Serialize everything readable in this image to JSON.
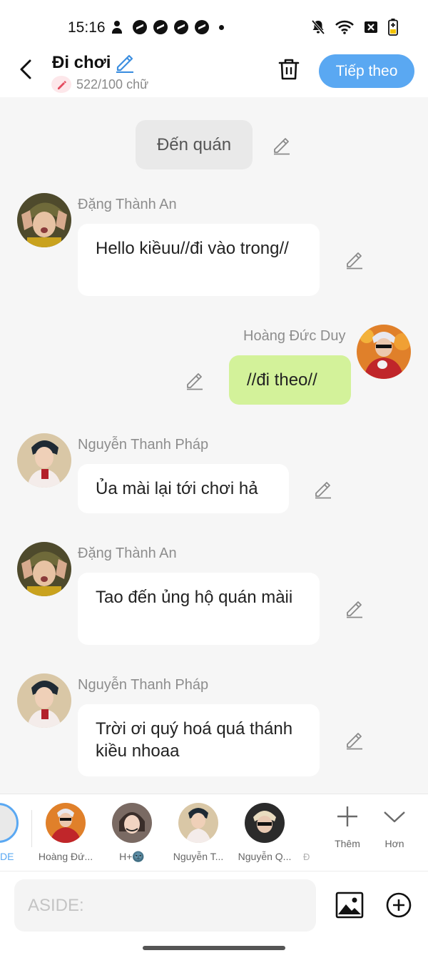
{
  "status_bar": {
    "time": "15:16"
  },
  "header": {
    "title": "Đi chơi",
    "counter": "522/100 chữ",
    "next_label": "Tiếp theo"
  },
  "chat": {
    "scene": "Đến quán",
    "messages": [
      {
        "sender": "Đặng Thành An",
        "text": "Hello kiềuu//đi vào trong//"
      },
      {
        "sender": "Hoàng Đức Duy",
        "text": "//đi theo//"
      },
      {
        "sender": "Nguyễn Thanh Pháp",
        "text": "Ủa mài lại tới chơi hả"
      },
      {
        "sender": "Đặng Thành An",
        "text": "Tao đến ủng hộ quán màii"
      },
      {
        "sender": "Nguyễn Thanh Pháp",
        "text": "Trời ơi quý hoá quá thánh kiều nhoaa"
      }
    ]
  },
  "characters": {
    "partial_label": "DE",
    "items": [
      {
        "label": "Hoàng Đứ...",
        "color": "#c0392b"
      },
      {
        "label": "H+🌚",
        "color": "#6e5a55"
      },
      {
        "label": "Nguyễn T...",
        "color": "#b89a7a"
      },
      {
        "label": "Nguyễn Q...",
        "color": "#2b2b2b"
      }
    ],
    "more_label": "Đ",
    "add_label": "Thêm",
    "collapse_label": "Hơn"
  },
  "composer": {
    "placeholder": "ASIDE:"
  },
  "colors": {
    "accent": "#5aa8f2",
    "mine_bubble": "#d3f29a"
  }
}
